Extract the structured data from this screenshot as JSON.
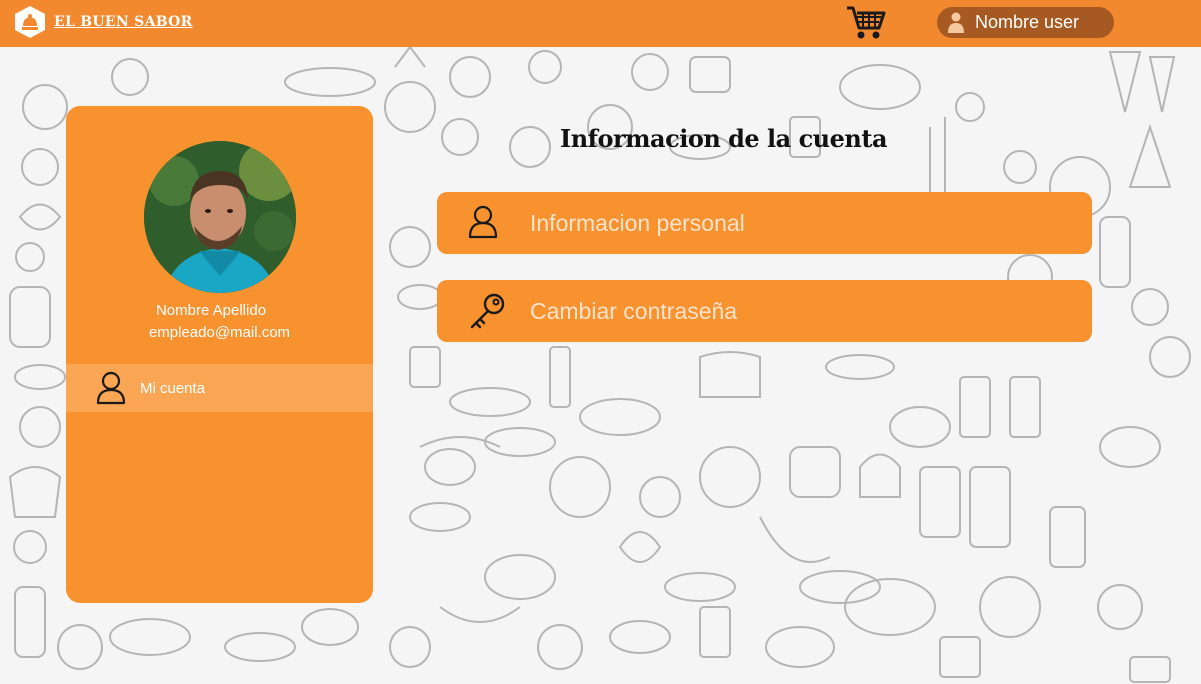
{
  "header": {
    "brand_name": "EL BUEN SABOR",
    "user_label": "Nombre user",
    "icons": {
      "logo": "hat-logo-icon",
      "cart": "shopping-cart-icon",
      "user": "user-icon"
    }
  },
  "sidebar": {
    "name": "Nombre Apellido",
    "email": "empleado@mail.com",
    "menu": [
      {
        "label": "Mi cuenta",
        "icon": "user-outline-icon"
      }
    ]
  },
  "main": {
    "title": "Informacion de la cuenta",
    "options": [
      {
        "label": "Informacion personal",
        "icon": "user-outline-icon"
      },
      {
        "label": "Cambiar contraseña",
        "icon": "key-icon"
      }
    ]
  },
  "colors": {
    "header_bg": "#f3892e",
    "panel_bg": "#f7922f",
    "menu_active_bg": "#faa654",
    "user_pill_bg": "#a65a22",
    "background": "#f5f5f5"
  }
}
